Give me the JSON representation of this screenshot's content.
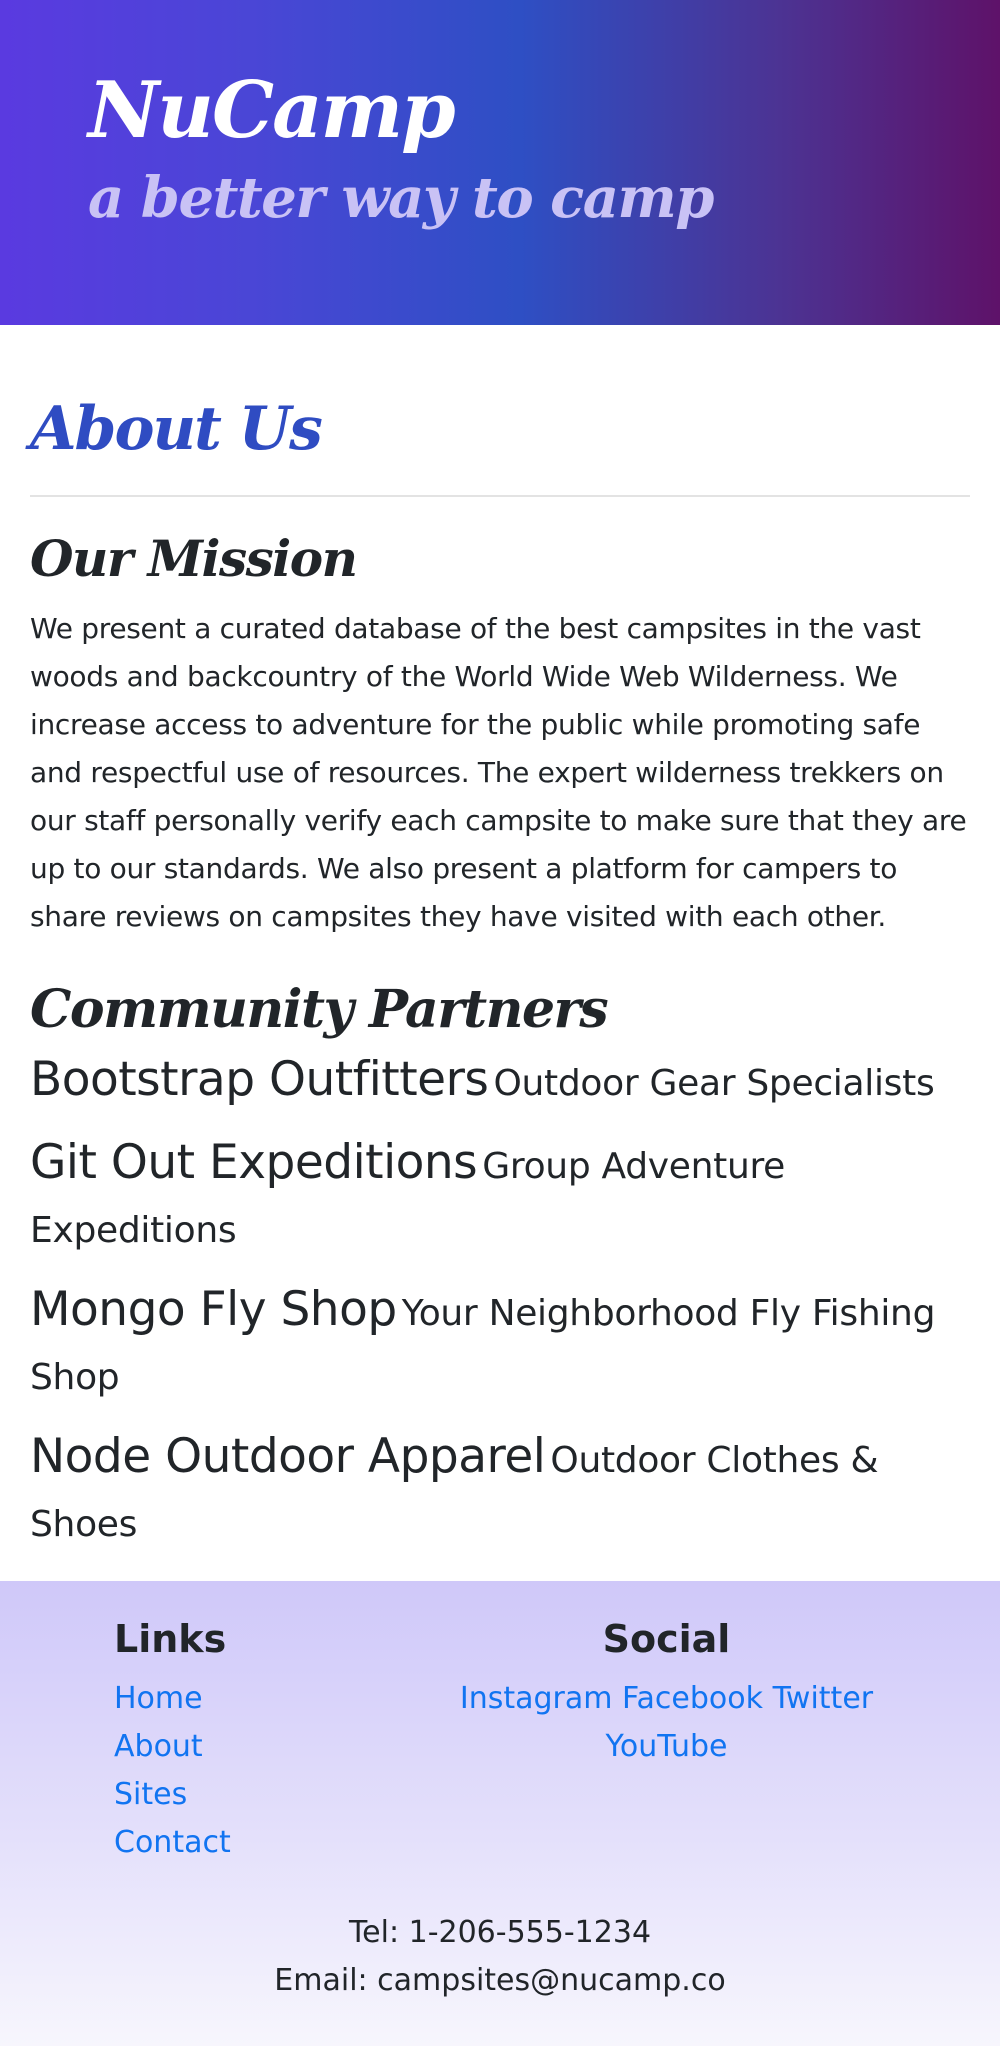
{
  "header": {
    "brand": "NuCamp",
    "tagline": "a better way to camp",
    "gradient_colors": [
      "#5a3ae0",
      "#2e4fc4",
      "#5e1269"
    ]
  },
  "about": {
    "title": "About Us",
    "title_color": "#2f4cc2"
  },
  "mission": {
    "title": "Our Mission",
    "text": "We present a curated database of the best campsites in the vast woods and backcountry of the World Wide Web Wilderness. We increase access to adventure for the public while promoting safe and respectful use of resources. The expert wilderness trekkers on our staff personally verify each campsite to make sure that they are up to our standards. We also present a platform for campers to share reviews on campsites they have visited with each other."
  },
  "partners": {
    "title": "Community Partners",
    "items": [
      {
        "name": "Bootstrap Outfitters",
        "desc": "Outdoor Gear Specialists"
      },
      {
        "name": "Git Out Expeditions",
        "desc": "Group Adventure Expeditions"
      },
      {
        "name": "Mongo Fly Shop",
        "desc": "Your Neighborhood Fly Fishing Shop"
      },
      {
        "name": "Node Outdoor Apparel",
        "desc": "Outdoor Clothes & Shoes"
      }
    ]
  },
  "footer": {
    "links_title": "Links",
    "links": [
      "Home",
      "About",
      "Sites",
      "Contact"
    ],
    "social_title": "Social",
    "social": [
      "Instagram",
      "Facebook",
      "Twitter",
      "YouTube"
    ],
    "tel": "Tel: 1-206-555-1234",
    "email": "Email: campsites@nucamp.co",
    "link_color": "#1174f1"
  }
}
